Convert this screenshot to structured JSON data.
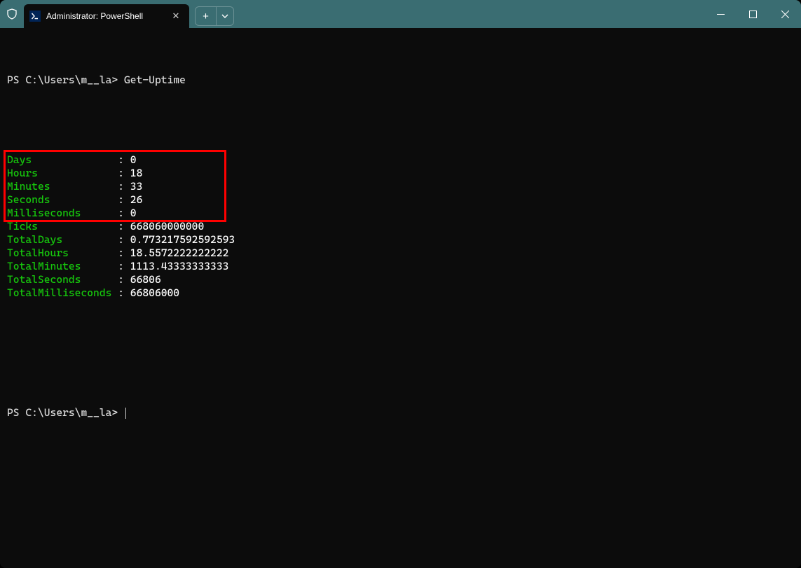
{
  "window": {
    "tab_title": "Administrator: PowerShell"
  },
  "terminal": {
    "prompt1_prefix": "PS ",
    "prompt1_path": "C:\\Users\\m__la>",
    "command1": "Get-Uptime",
    "prompt2_prefix": "PS ",
    "prompt2_path": "C:\\Users\\m__la>",
    "output": [
      {
        "label": "Days",
        "value": "0"
      },
      {
        "label": "Hours",
        "value": "18"
      },
      {
        "label": "Minutes",
        "value": "33"
      },
      {
        "label": "Seconds",
        "value": "26"
      },
      {
        "label": "Milliseconds",
        "value": "0"
      },
      {
        "label": "Ticks",
        "value": "668060000000"
      },
      {
        "label": "TotalDays",
        "value": "0.773217592592593"
      },
      {
        "label": "TotalHours",
        "value": "18.5572222222222"
      },
      {
        "label": "TotalMinutes",
        "value": "1113.43333333333"
      },
      {
        "label": "TotalSeconds",
        "value": "66806"
      },
      {
        "label": "TotalMilliseconds",
        "value": "66806000"
      }
    ],
    "highlight_rows": 5
  }
}
